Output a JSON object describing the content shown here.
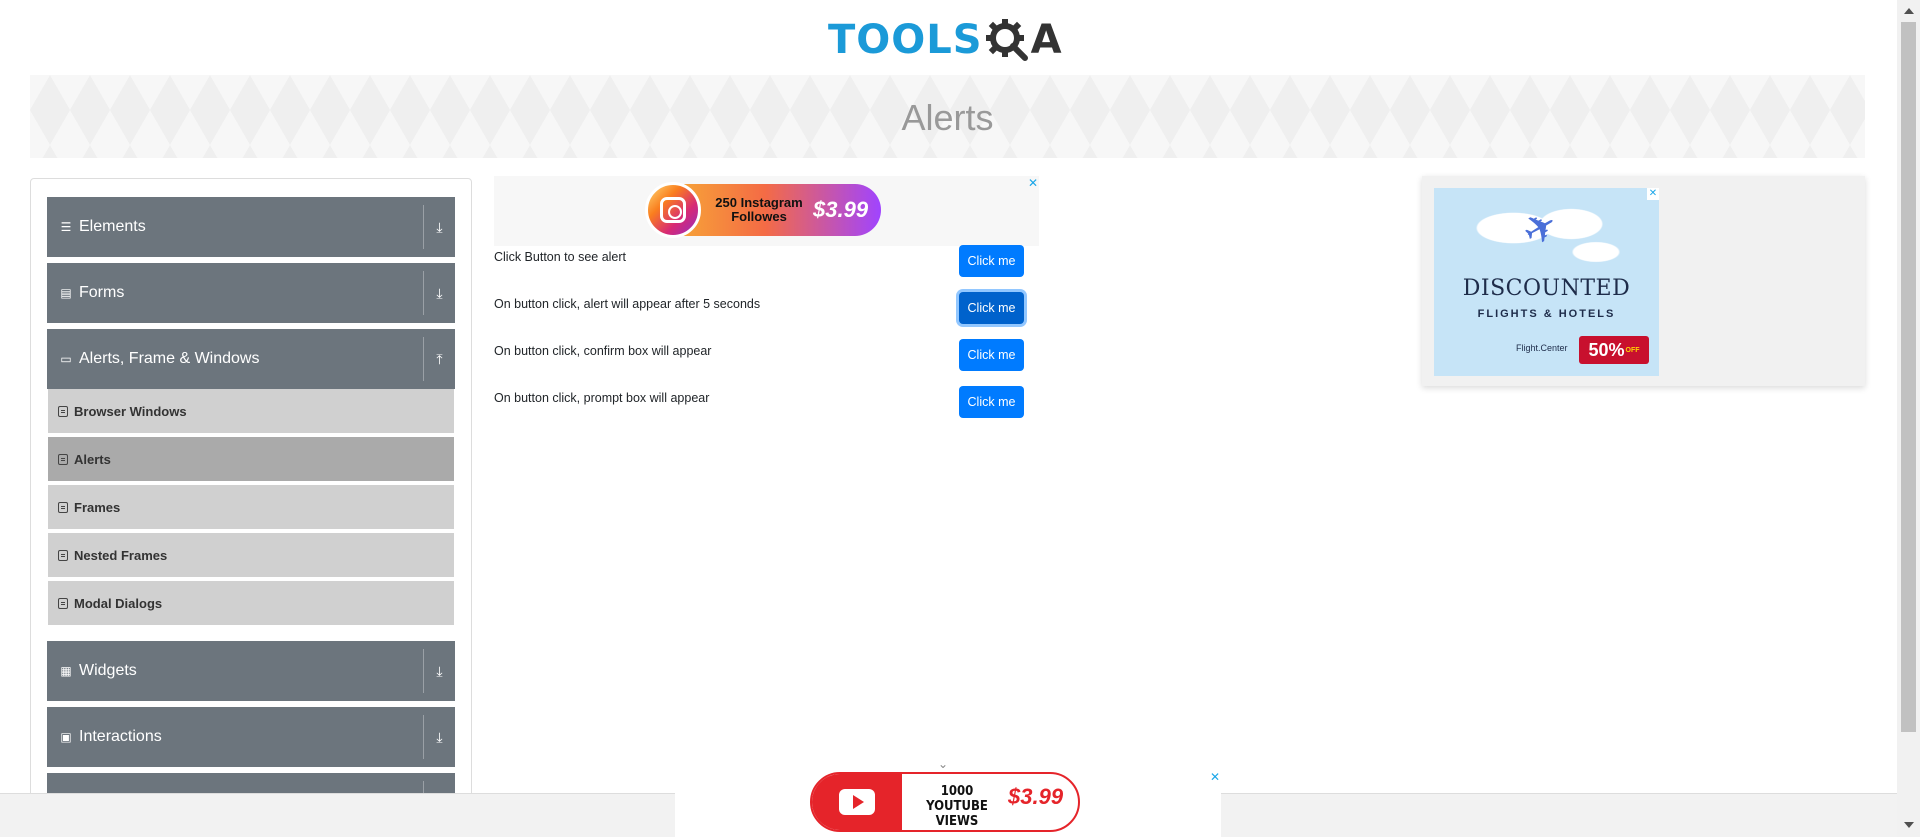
{
  "header": {
    "logo_text": "TOOLS",
    "logo_suffix": "A",
    "page_title": "Alerts"
  },
  "sidebar": {
    "groups": [
      {
        "label": "Elements",
        "icon": "list-icon",
        "toggle": "download-icon"
      },
      {
        "label": "Forms",
        "icon": "file-icon",
        "toggle": "download-icon"
      },
      {
        "label": "Alerts, Frame & Windows",
        "icon": "window-icon",
        "toggle": "upload-icon"
      },
      {
        "label": "Widgets",
        "icon": "grid-icon",
        "toggle": "download-icon"
      },
      {
        "label": "Interactions",
        "icon": "square-icon",
        "toggle": "download-icon"
      }
    ],
    "items": [
      {
        "label": "Browser Windows",
        "active": false
      },
      {
        "label": "Alerts",
        "active": true
      },
      {
        "label": "Frames",
        "active": false
      },
      {
        "label": "Nested Frames",
        "active": false
      },
      {
        "label": "Modal Dialogs",
        "active": false
      }
    ]
  },
  "ads": {
    "top": {
      "text": "250 Instagram Followes",
      "price": "$3.99",
      "close": "✕"
    },
    "right": {
      "title": "DISCOUNTED",
      "subtitle": "FLIGHTS & HOTELS",
      "brand": "Flight.Center",
      "discount": "50%",
      "discount_suffix": "OFF",
      "close": "✕"
    },
    "bottom": {
      "text": "1000 YOUTUBE VIEWS",
      "price": "$3.99",
      "close": "✕",
      "chevron": "⌄"
    }
  },
  "alerts": [
    {
      "text": "Click Button to see alert",
      "button": "Click me",
      "focused": false
    },
    {
      "text": "On button click, alert will appear after 5 seconds",
      "button": "Click me",
      "focused": true
    },
    {
      "text": "On button click, confirm box will appear",
      "button": "Click me",
      "focused": false
    },
    {
      "text": "On button click, prompt box will appear",
      "button": "Click me",
      "focused": false
    }
  ],
  "colors": {
    "primary": "#007bff",
    "sidebar_header": "#6c757d",
    "logo": "#1b9ad8"
  }
}
